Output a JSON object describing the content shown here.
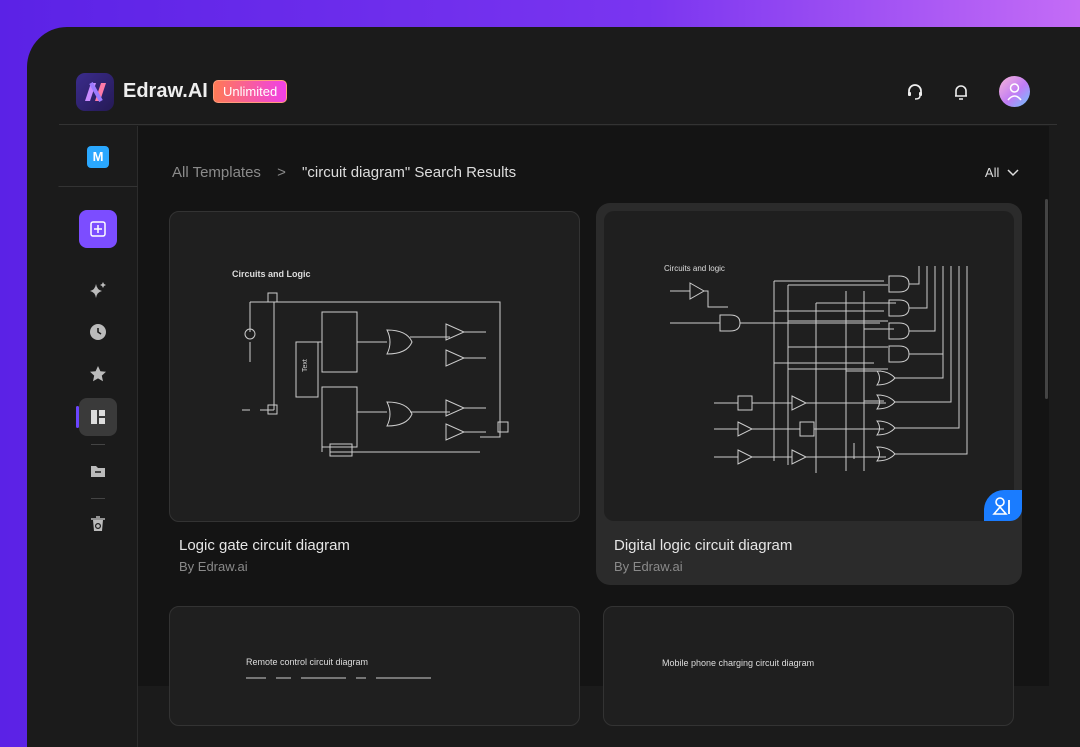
{
  "app": {
    "name": "Edraw.AI",
    "plan_badge": "Unlimited",
    "workspace_initial": "M"
  },
  "header": {
    "icons": [
      "headset-icon",
      "bell-icon",
      "avatar"
    ]
  },
  "sidebar": {
    "items": [
      {
        "icon": "new-file-icon"
      },
      {
        "icon": "sparkle-icon"
      },
      {
        "icon": "clock-icon"
      },
      {
        "icon": "star-icon"
      },
      {
        "icon": "templates-icon",
        "active": true
      },
      {
        "icon": "folder-icon"
      },
      {
        "icon": "trash-icon"
      }
    ]
  },
  "breadcrumb": {
    "root": "All Templates",
    "separator": ">",
    "current": "\"circuit diagram\" Search Results"
  },
  "filter": {
    "value": "All"
  },
  "cards": [
    {
      "title": "Logic gate circuit diagram",
      "author": "By Edraw.ai",
      "thumb_title": "Circuits and Logic",
      "thumb_label": "Text"
    },
    {
      "title": "Digital logic circuit diagram",
      "author": "By Edraw.ai",
      "thumb_title": "Circuits and logic",
      "hovered": true,
      "badge_icon": "community-icon"
    },
    {
      "thumb_title": "Remote control circuit diagram"
    },
    {
      "thumb_title": "Mobile phone charging circuit diagram"
    }
  ],
  "colors": {
    "accent": "#7c4dff",
    "badge_blue": "#1a7cff",
    "workspace": "#2aa8ff"
  }
}
